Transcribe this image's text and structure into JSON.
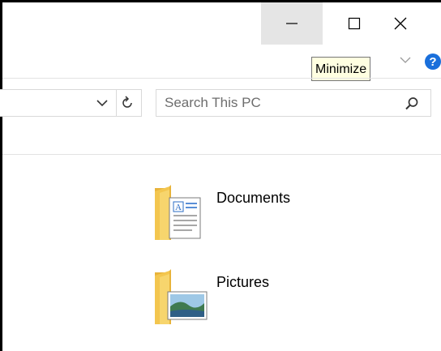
{
  "titlebar": {
    "minimize_tooltip": "Minimize"
  },
  "search": {
    "placeholder": "Search This PC"
  },
  "items": [
    {
      "label": "Documents",
      "icon": "documents-folder-icon"
    },
    {
      "label": "Pictures",
      "icon": "pictures-folder-icon"
    }
  ],
  "colors": {
    "hover_button": "#e5e5e5",
    "tooltip_bg": "#ffffe1",
    "help_blue": "#1a6fdb",
    "folder_yellow": "#f3c64f"
  }
}
